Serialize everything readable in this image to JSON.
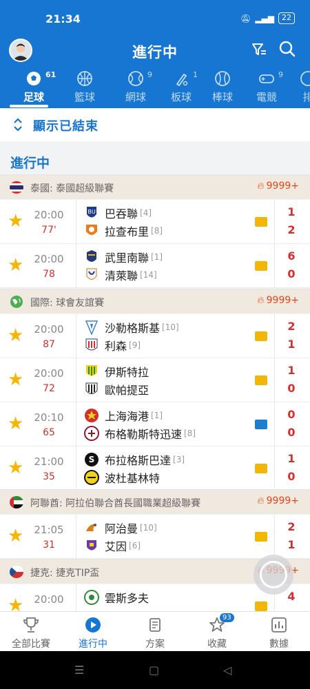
{
  "status_bar": {
    "time": "21:34",
    "battery": "22"
  },
  "header": {
    "title": "進行中"
  },
  "tabs": [
    {
      "label": "足球",
      "count": "61",
      "icon": "soccer-ball-icon",
      "active": true
    },
    {
      "label": "籃球",
      "count": "",
      "icon": "basketball-icon"
    },
    {
      "label": "網球",
      "count": "9",
      "icon": "tennis-ball-icon"
    },
    {
      "label": "板球",
      "count": "1",
      "icon": "cricket-bat-icon"
    },
    {
      "label": "棒球",
      "count": "",
      "icon": "baseball-icon"
    },
    {
      "label": "電競",
      "count": "9",
      "icon": "gamepad-icon"
    },
    {
      "label": "排",
      "count": "",
      "icon": "volleyball-icon"
    }
  ],
  "show_ended": {
    "label": "顯示已結束"
  },
  "section": {
    "title": "進行中"
  },
  "leagues": [
    {
      "name": "泰國: 泰國超級聯賽",
      "hot": "9999+",
      "flag": "thailand-flag",
      "matches": [
        {
          "time": "20:00",
          "minute": "77'",
          "home": "巴吞聯",
          "home_rank": "[4]",
          "away": "拉查布里",
          "away_rank": "[8]",
          "home_score": "1",
          "away_score": "2"
        },
        {
          "time": "20:00",
          "minute": "78",
          "home": "武里南聯",
          "home_rank": "[1]",
          "away": "清萊聯",
          "away_rank": "[14]",
          "home_score": "6",
          "away_score": "0"
        }
      ]
    },
    {
      "name": "國際: 球會友誼賽",
      "hot": "9999+",
      "flag": "globe-flag",
      "matches": [
        {
          "time": "20:00",
          "minute": "87",
          "home": "沙勒格斯基",
          "home_rank": "[10]",
          "away": "利森",
          "away_rank": "[9]",
          "home_score": "2",
          "away_score": "1"
        },
        {
          "time": "20:00",
          "minute": "72",
          "home": "伊斯特拉",
          "home_rank": "",
          "away": "歐帕提亞",
          "away_rank": "",
          "home_score": "1",
          "away_score": "0"
        },
        {
          "time": "20:10",
          "minute": "65",
          "home": "上海海港",
          "home_rank": "[1]",
          "away": "布格勒斯特迅速",
          "away_rank": "[8]",
          "home_score": "0",
          "away_score": "0",
          "video": true
        },
        {
          "time": "21:00",
          "minute": "35",
          "home": "布拉格斯巴達",
          "home_rank": "[3]",
          "away": "波杜基林特",
          "away_rank": "",
          "home_score": "1",
          "away_score": "0"
        }
      ]
    },
    {
      "name": "阿聯酋: 阿拉伯聯合酋長國職業超級聯賽",
      "hot": "9999+",
      "flag": "uae-flag",
      "matches": [
        {
          "time": "21:05",
          "minute": "31",
          "home": "阿治曼",
          "home_rank": "[10]",
          "away": "艾因",
          "away_rank": "[6]",
          "home_score": "2",
          "away_score": "1"
        }
      ]
    },
    {
      "name": "捷克: 捷克TIP盃",
      "hot": "9999+",
      "flag": "czech-flag",
      "matches": [
        {
          "time": "20:00",
          "minute": "",
          "home": "雲斯多夫",
          "home_rank": "",
          "away": "",
          "away_rank": "",
          "home_score": "4",
          "away_score": ""
        }
      ]
    }
  ],
  "bottom_nav": [
    {
      "label": "全部比賽",
      "icon": "trophy-icon"
    },
    {
      "label": "進行中",
      "icon": "play-circle-icon",
      "active": true
    },
    {
      "label": "方案",
      "icon": "document-icon"
    },
    {
      "label": "收藏",
      "icon": "star-outline-icon",
      "badge": "93"
    },
    {
      "label": "數據",
      "icon": "bar-chart-icon"
    }
  ],
  "colors": {
    "primary": "#1676d2",
    "score_red": "#d32f2f",
    "star": "#f7b500",
    "league_bg": "#f0e9e0",
    "hot": "#e8431b"
  }
}
